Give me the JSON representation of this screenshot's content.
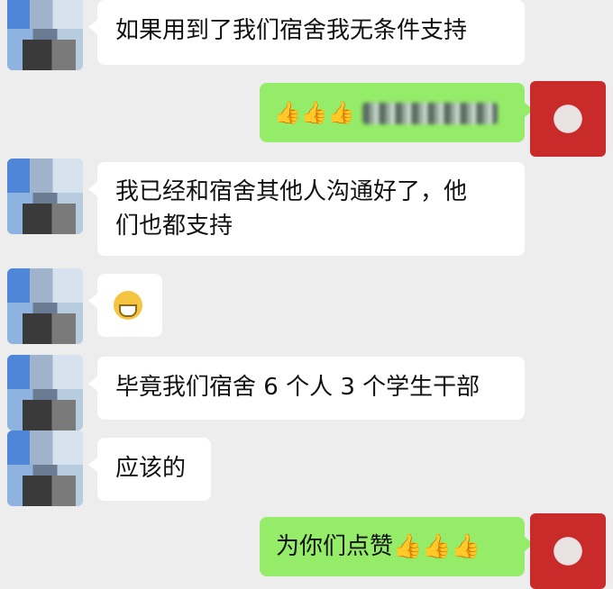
{
  "messages": [
    {
      "side": "in",
      "text": "如果用到了我们宿舍我无条件支持"
    },
    {
      "side": "out",
      "text": "👍👍👍"
    },
    {
      "side": "in",
      "line1": "我已经和宿舍其他人沟通好了，他",
      "line2": "们也都支持"
    },
    {
      "side": "in",
      "text": "😁"
    },
    {
      "side": "in",
      "text": "毕竟我们宿舍 6 个人 3 个学生干部"
    },
    {
      "side": "in",
      "text": "应该的"
    },
    {
      "side": "out",
      "text": "为你们点赞👍👍👍"
    }
  ]
}
